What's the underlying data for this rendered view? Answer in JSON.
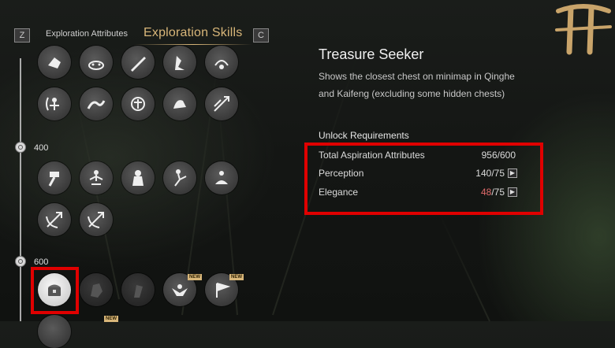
{
  "tabs": {
    "prev_key": "Z",
    "prev_label": "Exploration Attributes",
    "active_label": "Exploration Skills",
    "next_key": "C"
  },
  "levels": [
    "400",
    "600"
  ],
  "skills": {
    "row1": [
      "skill-1",
      "skill-2",
      "skill-3",
      "skill-4",
      "skill-5"
    ],
    "row2": [
      "skill-archer",
      "skill-wave",
      "skill-martial",
      "skill-beast",
      "skill-arrows"
    ],
    "row3": [
      "skill-hammer",
      "skill-meditate",
      "skill-guardian",
      "skill-kick",
      "skill-sit"
    ],
    "row4": [
      "skill-arrow-left",
      "skill-arrow-right"
    ],
    "row5": [
      "treasure-seeker",
      "skill-locked-1",
      "skill-locked-2",
      "skill-eagle",
      "skill-flag"
    ],
    "badges": {
      "new": "NEW"
    }
  },
  "detail": {
    "title": "Treasure Seeker",
    "description": "Shows the closest chest on minimap in Qinghe and Kaifeng (excluding some hidden chests)",
    "requirements_title": "Unlock Requirements",
    "requirements": [
      {
        "label": "Total Aspiration Attributes",
        "current": "956",
        "required": "/600",
        "met": true
      },
      {
        "label": "Perception",
        "current": "140",
        "required": "/75",
        "met": true
      },
      {
        "label": "Elegance",
        "current": "48",
        "required": "/75",
        "met": false
      }
    ]
  },
  "colors": {
    "accent": "#d8b679",
    "highlight": "#e00000",
    "unmet": "#e06a6a"
  }
}
